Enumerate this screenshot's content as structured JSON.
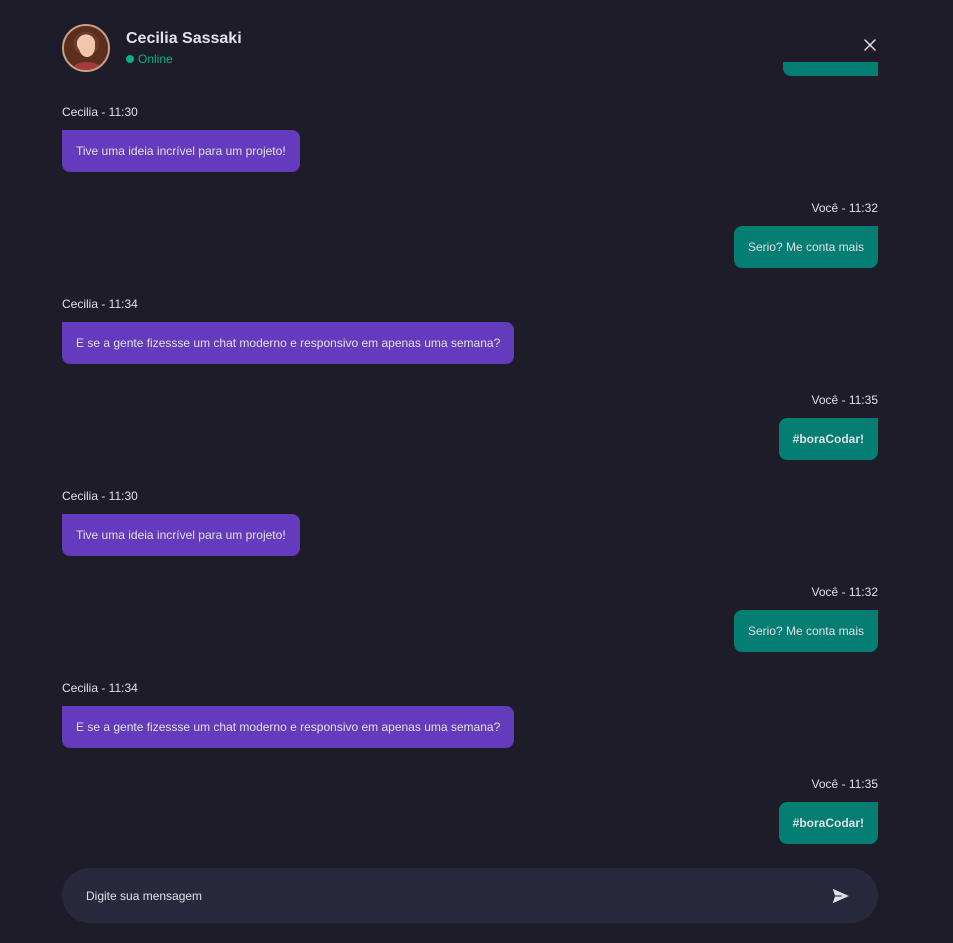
{
  "header": {
    "contact_name": "Cecilia Sassaki",
    "status": "Online",
    "avatar_icon": "avatar-photo",
    "close_icon": "close-icon"
  },
  "colors": {
    "background": "#1e1c28",
    "received_bubble": "#633bbc",
    "sent_bubble": "#047d73",
    "online": "#00b37e",
    "composer": "#29293e"
  },
  "messages": [
    {
      "sender": "Cecilia - 11:30",
      "text": "Tive uma ideia incrível para um projeto!",
      "direction": "received"
    },
    {
      "sender": "Você - 11:32",
      "text": "Serio? Me conta mais",
      "direction": "sent"
    },
    {
      "sender": "Cecilia - 11:34",
      "text": "E se a gente fizessse um chat moderno e responsivo em apenas uma semana?",
      "direction": "received"
    },
    {
      "sender": "Você - 11:35",
      "text": "#boraCodar!",
      "direction": "sent"
    },
    {
      "sender": "Cecilia - 11:30",
      "text": "Tive uma ideia incrível para um projeto!",
      "direction": "received"
    },
    {
      "sender": "Você - 11:32",
      "text": "Serio? Me conta mais",
      "direction": "sent"
    },
    {
      "sender": "Cecilia - 11:34",
      "text": "E se a gente fizessse um chat moderno e responsivo em apenas uma semana?",
      "direction": "received"
    },
    {
      "sender": "Você - 11:35",
      "text": "#boraCodar!",
      "direction": "sent"
    }
  ],
  "composer": {
    "placeholder": "Digite sua mensagem",
    "send_icon": "send-icon"
  }
}
